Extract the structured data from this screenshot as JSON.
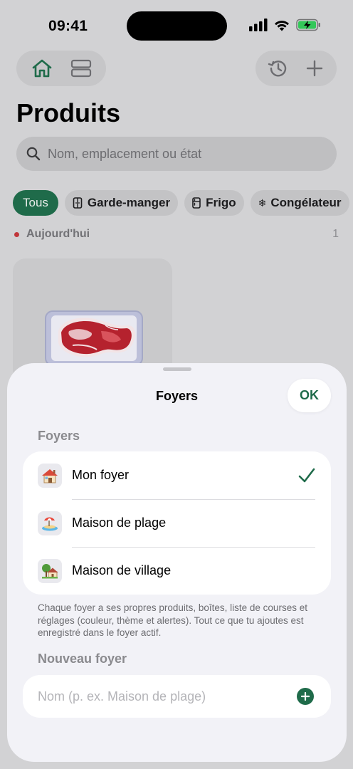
{
  "status_bar": {
    "time": "09:41"
  },
  "header": {
    "title": "Produits"
  },
  "search": {
    "placeholder": "Nom, emplacement ou état"
  },
  "filters": [
    {
      "label": "Tous",
      "icon": ""
    },
    {
      "label": "Garde-manger",
      "icon": "cabinet-icon"
    },
    {
      "label": "Frigo",
      "icon": "fridge-icon"
    },
    {
      "label": "Congélateur",
      "icon": "snowflake-icon"
    }
  ],
  "section": {
    "label": "Aujourd'hui",
    "count": "1"
  },
  "sheet": {
    "title": "Foyers",
    "ok_label": "OK",
    "group_label": "Foyers",
    "households": [
      {
        "emoji": "🏠",
        "name": "Mon foyer",
        "selected": true
      },
      {
        "emoji": "🏖️",
        "name": "Maison de plage",
        "selected": false
      },
      {
        "emoji": "🏡",
        "name": "Maison de village",
        "selected": false
      }
    ],
    "footnote": "Chaque foyer a ses propres produits, boîtes, liste de courses et réglages (couleur, thème et alertes). Tout ce que tu ajoutes est enregistré dans le foyer actif.",
    "new_label": "Nouveau foyer",
    "new_placeholder": "Nom (p. ex. Maison de plage)"
  },
  "colors": {
    "accent": "#1f6b4a",
    "today_dot": "#c0363a"
  }
}
